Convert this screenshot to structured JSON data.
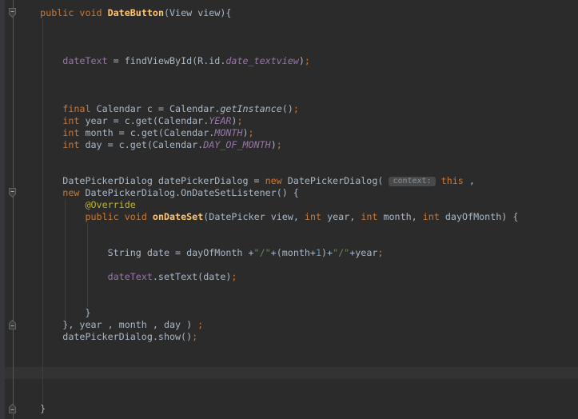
{
  "editor": {
    "language": "java",
    "caret_row": 31,
    "colors": {
      "background": "#2b2b2b",
      "caret_line": "#333333",
      "default_text": "#a9b7c6",
      "keyword": "#cc7832",
      "method_declaration": "#ffc66d",
      "field": "#9876aa",
      "static_member": "#9876aa",
      "annotation": "#bbb529",
      "string": "#6a8759",
      "number": "#6897bb",
      "semicolon": "#cc7832",
      "parameter_hint_bg": "#48494b",
      "parameter_hint_text": "#8d9193"
    },
    "lines": [
      {
        "n": 1,
        "segments": [
          {
            "t": "    ",
            "s": "def"
          },
          {
            "t": "public void ",
            "s": "kw"
          },
          {
            "t": "DateButton",
            "s": "decl"
          },
          {
            "t": "(View view){",
            "s": "def"
          }
        ]
      },
      {
        "n": 2,
        "segments": []
      },
      {
        "n": 3,
        "segments": []
      },
      {
        "n": 4,
        "segments": []
      },
      {
        "n": 5,
        "segments": [
          {
            "t": "        ",
            "s": "def"
          },
          {
            "t": "dateText",
            "s": "field"
          },
          {
            "t": " = findViewById(R.id.",
            "s": "def"
          },
          {
            "t": "date_textview",
            "s": "sfield"
          },
          {
            "t": ")",
            "s": "def"
          },
          {
            "t": ";",
            "s": "semi"
          }
        ]
      },
      {
        "n": 6,
        "segments": []
      },
      {
        "n": 7,
        "segments": []
      },
      {
        "n": 8,
        "segments": []
      },
      {
        "n": 9,
        "segments": [
          {
            "t": "        ",
            "s": "def"
          },
          {
            "t": "final ",
            "s": "kw"
          },
          {
            "t": "Calendar c = Calendar.",
            "s": "def"
          },
          {
            "t": "getInstance",
            "s": "smethod"
          },
          {
            "t": "()",
            "s": "def"
          },
          {
            "t": ";",
            "s": "semi"
          }
        ]
      },
      {
        "n": 10,
        "segments": [
          {
            "t": "        ",
            "s": "def"
          },
          {
            "t": "int ",
            "s": "kw"
          },
          {
            "t": "year = c.get(Calendar.",
            "s": "def"
          },
          {
            "t": "YEAR",
            "s": "sfield"
          },
          {
            "t": ")",
            "s": "def"
          },
          {
            "t": ";",
            "s": "semi"
          }
        ]
      },
      {
        "n": 11,
        "segments": [
          {
            "t": "        ",
            "s": "def"
          },
          {
            "t": "int ",
            "s": "kw"
          },
          {
            "t": "month = c.get(Calendar.",
            "s": "def"
          },
          {
            "t": "MONTH",
            "s": "sfield"
          },
          {
            "t": ")",
            "s": "def"
          },
          {
            "t": ";",
            "s": "semi"
          }
        ]
      },
      {
        "n": 12,
        "segments": [
          {
            "t": "        ",
            "s": "def"
          },
          {
            "t": "int ",
            "s": "kw"
          },
          {
            "t": "day = c.get(Calendar.",
            "s": "def"
          },
          {
            "t": "DAY_OF_MONTH",
            "s": "sfield"
          },
          {
            "t": ")",
            "s": "def"
          },
          {
            "t": ";",
            "s": "semi"
          }
        ]
      },
      {
        "n": 13,
        "segments": []
      },
      {
        "n": 14,
        "segments": []
      },
      {
        "n": 15,
        "segments": [
          {
            "t": "        DatePickerDialog datePickerDialog = ",
            "s": "def"
          },
          {
            "t": "new ",
            "s": "kw"
          },
          {
            "t": "DatePickerDialog( ",
            "s": "def"
          },
          {
            "t": "context:",
            "s": "hint"
          },
          {
            "t": " ",
            "s": "def"
          },
          {
            "t": "this",
            "s": "kw"
          },
          {
            "t": " ,",
            "s": "def"
          }
        ]
      },
      {
        "n": 16,
        "segments": [
          {
            "t": "        ",
            "s": "def"
          },
          {
            "t": "new ",
            "s": "kw"
          },
          {
            "t": "DatePickerDialog.OnDateSetListener() {",
            "s": "def"
          }
        ]
      },
      {
        "n": 17,
        "segments": [
          {
            "t": "            ",
            "s": "def"
          },
          {
            "t": "@Override",
            "s": "ann"
          }
        ]
      },
      {
        "n": 18,
        "segments": [
          {
            "t": "            ",
            "s": "def"
          },
          {
            "t": "public void ",
            "s": "kw"
          },
          {
            "t": "onDateSet",
            "s": "decl"
          },
          {
            "t": "(DatePicker view, ",
            "s": "def"
          },
          {
            "t": "int ",
            "s": "kw"
          },
          {
            "t": "year, ",
            "s": "def"
          },
          {
            "t": "int ",
            "s": "kw"
          },
          {
            "t": "month, ",
            "s": "def"
          },
          {
            "t": "int ",
            "s": "kw"
          },
          {
            "t": "dayOfMonth) {",
            "s": "def"
          }
        ]
      },
      {
        "n": 19,
        "segments": []
      },
      {
        "n": 20,
        "segments": []
      },
      {
        "n": 21,
        "segments": [
          {
            "t": "                String date = dayOfMonth +",
            "s": "def"
          },
          {
            "t": "\"/\"",
            "s": "str"
          },
          {
            "t": "+(month+",
            "s": "def"
          },
          {
            "t": "1",
            "s": "num"
          },
          {
            "t": ")+",
            "s": "def"
          },
          {
            "t": "\"/\"",
            "s": "str"
          },
          {
            "t": "+year",
            "s": "def"
          },
          {
            "t": ";",
            "s": "semi"
          }
        ]
      },
      {
        "n": 22,
        "segments": []
      },
      {
        "n": 23,
        "segments": [
          {
            "t": "                ",
            "s": "def"
          },
          {
            "t": "dateText",
            "s": "field"
          },
          {
            "t": ".setText(date)",
            "s": "def"
          },
          {
            "t": ";",
            "s": "semi"
          }
        ]
      },
      {
        "n": 24,
        "segments": []
      },
      {
        "n": 25,
        "segments": []
      },
      {
        "n": 26,
        "segments": [
          {
            "t": "            }",
            "s": "def"
          }
        ]
      },
      {
        "n": 27,
        "segments": [
          {
            "t": "        }, year , month , day ) ",
            "s": "def"
          },
          {
            "t": ";",
            "s": "semi"
          }
        ]
      },
      {
        "n": 28,
        "segments": [
          {
            "t": "        datePickerDialog.show()",
            "s": "def"
          },
          {
            "t": ";",
            "s": "semi"
          }
        ]
      },
      {
        "n": 29,
        "segments": []
      },
      {
        "n": 30,
        "segments": []
      },
      {
        "n": 31,
        "segments": []
      },
      {
        "n": 32,
        "segments": []
      },
      {
        "n": 33,
        "segments": []
      },
      {
        "n": 34,
        "segments": [
          {
            "t": "    }",
            "s": "def"
          }
        ]
      }
    ]
  },
  "gutter": {
    "fold_markers": [
      {
        "row": 1,
        "dir": "collapse"
      },
      {
        "row": 16,
        "dir": "collapse"
      },
      {
        "row": 27,
        "dir": "expand"
      },
      {
        "row": 34,
        "dir": "expand"
      }
    ]
  }
}
